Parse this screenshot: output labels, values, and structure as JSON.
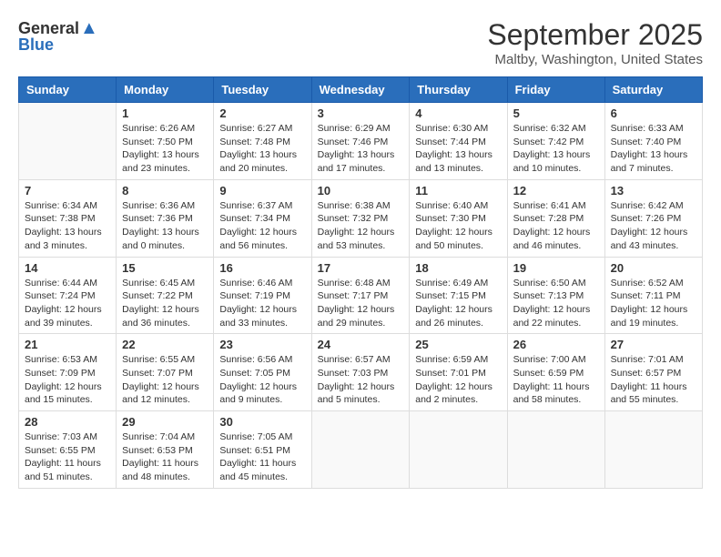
{
  "logo": {
    "general": "General",
    "blue": "Blue"
  },
  "title": "September 2025",
  "subtitle": "Maltby, Washington, United States",
  "days_of_week": [
    "Sunday",
    "Monday",
    "Tuesday",
    "Wednesday",
    "Thursday",
    "Friday",
    "Saturday"
  ],
  "weeks": [
    [
      {
        "day": "",
        "info": ""
      },
      {
        "day": "1",
        "info": "Sunrise: 6:26 AM\nSunset: 7:50 PM\nDaylight: 13 hours\nand 23 minutes."
      },
      {
        "day": "2",
        "info": "Sunrise: 6:27 AM\nSunset: 7:48 PM\nDaylight: 13 hours\nand 20 minutes."
      },
      {
        "day": "3",
        "info": "Sunrise: 6:29 AM\nSunset: 7:46 PM\nDaylight: 13 hours\nand 17 minutes."
      },
      {
        "day": "4",
        "info": "Sunrise: 6:30 AM\nSunset: 7:44 PM\nDaylight: 13 hours\nand 13 minutes."
      },
      {
        "day": "5",
        "info": "Sunrise: 6:32 AM\nSunset: 7:42 PM\nDaylight: 13 hours\nand 10 minutes."
      },
      {
        "day": "6",
        "info": "Sunrise: 6:33 AM\nSunset: 7:40 PM\nDaylight: 13 hours\nand 7 minutes."
      }
    ],
    [
      {
        "day": "7",
        "info": "Sunrise: 6:34 AM\nSunset: 7:38 PM\nDaylight: 13 hours\nand 3 minutes."
      },
      {
        "day": "8",
        "info": "Sunrise: 6:36 AM\nSunset: 7:36 PM\nDaylight: 13 hours\nand 0 minutes."
      },
      {
        "day": "9",
        "info": "Sunrise: 6:37 AM\nSunset: 7:34 PM\nDaylight: 12 hours\nand 56 minutes."
      },
      {
        "day": "10",
        "info": "Sunrise: 6:38 AM\nSunset: 7:32 PM\nDaylight: 12 hours\nand 53 minutes."
      },
      {
        "day": "11",
        "info": "Sunrise: 6:40 AM\nSunset: 7:30 PM\nDaylight: 12 hours\nand 50 minutes."
      },
      {
        "day": "12",
        "info": "Sunrise: 6:41 AM\nSunset: 7:28 PM\nDaylight: 12 hours\nand 46 minutes."
      },
      {
        "day": "13",
        "info": "Sunrise: 6:42 AM\nSunset: 7:26 PM\nDaylight: 12 hours\nand 43 minutes."
      }
    ],
    [
      {
        "day": "14",
        "info": "Sunrise: 6:44 AM\nSunset: 7:24 PM\nDaylight: 12 hours\nand 39 minutes."
      },
      {
        "day": "15",
        "info": "Sunrise: 6:45 AM\nSunset: 7:22 PM\nDaylight: 12 hours\nand 36 minutes."
      },
      {
        "day": "16",
        "info": "Sunrise: 6:46 AM\nSunset: 7:19 PM\nDaylight: 12 hours\nand 33 minutes."
      },
      {
        "day": "17",
        "info": "Sunrise: 6:48 AM\nSunset: 7:17 PM\nDaylight: 12 hours\nand 29 minutes."
      },
      {
        "day": "18",
        "info": "Sunrise: 6:49 AM\nSunset: 7:15 PM\nDaylight: 12 hours\nand 26 minutes."
      },
      {
        "day": "19",
        "info": "Sunrise: 6:50 AM\nSunset: 7:13 PM\nDaylight: 12 hours\nand 22 minutes."
      },
      {
        "day": "20",
        "info": "Sunrise: 6:52 AM\nSunset: 7:11 PM\nDaylight: 12 hours\nand 19 minutes."
      }
    ],
    [
      {
        "day": "21",
        "info": "Sunrise: 6:53 AM\nSunset: 7:09 PM\nDaylight: 12 hours\nand 15 minutes."
      },
      {
        "day": "22",
        "info": "Sunrise: 6:55 AM\nSunset: 7:07 PM\nDaylight: 12 hours\nand 12 minutes."
      },
      {
        "day": "23",
        "info": "Sunrise: 6:56 AM\nSunset: 7:05 PM\nDaylight: 12 hours\nand 9 minutes."
      },
      {
        "day": "24",
        "info": "Sunrise: 6:57 AM\nSunset: 7:03 PM\nDaylight: 12 hours\nand 5 minutes."
      },
      {
        "day": "25",
        "info": "Sunrise: 6:59 AM\nSunset: 7:01 PM\nDaylight: 12 hours\nand 2 minutes."
      },
      {
        "day": "26",
        "info": "Sunrise: 7:00 AM\nSunset: 6:59 PM\nDaylight: 11 hours\nand 58 minutes."
      },
      {
        "day": "27",
        "info": "Sunrise: 7:01 AM\nSunset: 6:57 PM\nDaylight: 11 hours\nand 55 minutes."
      }
    ],
    [
      {
        "day": "28",
        "info": "Sunrise: 7:03 AM\nSunset: 6:55 PM\nDaylight: 11 hours\nand 51 minutes."
      },
      {
        "day": "29",
        "info": "Sunrise: 7:04 AM\nSunset: 6:53 PM\nDaylight: 11 hours\nand 48 minutes."
      },
      {
        "day": "30",
        "info": "Sunrise: 7:05 AM\nSunset: 6:51 PM\nDaylight: 11 hours\nand 45 minutes."
      },
      {
        "day": "",
        "info": ""
      },
      {
        "day": "",
        "info": ""
      },
      {
        "day": "",
        "info": ""
      },
      {
        "day": "",
        "info": ""
      }
    ]
  ]
}
